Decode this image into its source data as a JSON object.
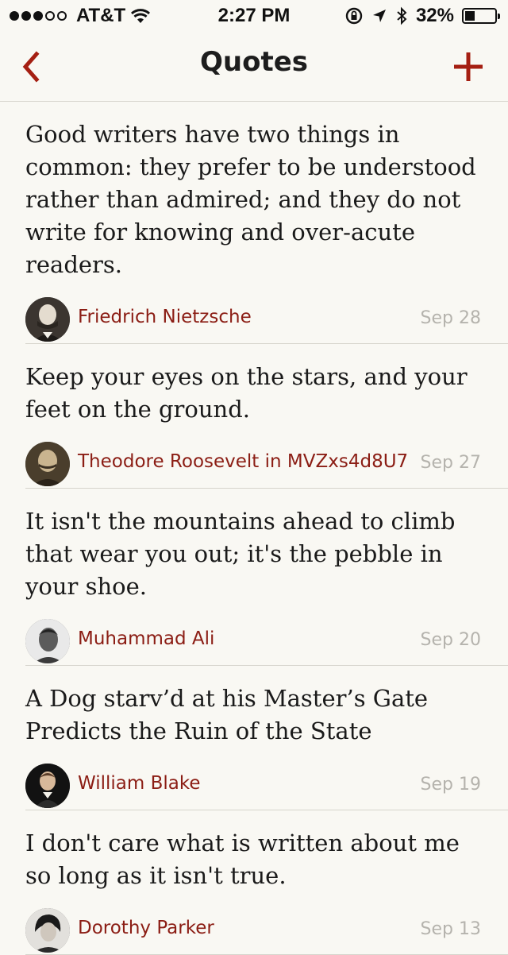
{
  "status_bar": {
    "carrier": "AT&T",
    "time": "2:27 PM",
    "battery": "32%",
    "battery_level": 0.32,
    "signal_bars_filled": 3,
    "signal_bars_total": 5,
    "icons": [
      "wifi-icon",
      "orientation-lock-icon",
      "location-arrow-icon",
      "bluetooth-icon",
      "battery-icon"
    ]
  },
  "nav": {
    "title": "Quotes",
    "back_icon": "chevron-left-icon",
    "add_icon": "plus-icon"
  },
  "colors": {
    "accent": "#a51f12",
    "author": "#8b1d14",
    "background": "#f9f8f3",
    "divider": "#d6d4cc",
    "date": "#b5b3ad"
  },
  "quotes": [
    {
      "text": "Good writers have two things in common: they prefer to be understood rather than admired; and they do not write for knowing and over-acute readers.",
      "author": "Friedrich Nietzsche",
      "date": "Sep 28"
    },
    {
      "text": "Keep your eyes on the stars, and your feet on the ground.",
      "author": "Theodore Roosevelt in MVZxs4d8U7",
      "date": "Sep 27"
    },
    {
      "text": "It isn't the mountains ahead to climb that wear you out; it's the pebble in your shoe.",
      "author": "Muhammad Ali",
      "date": "Sep 20"
    },
    {
      "text": "A Dog starv’d at his Master’s Gate Predicts the Ruin of the State",
      "author": "William Blake",
      "date": "Sep 19"
    },
    {
      "text": "I don't care what is written about me so long as it isn't true.",
      "author": "Dorothy Parker",
      "date": "Sep 13"
    }
  ]
}
